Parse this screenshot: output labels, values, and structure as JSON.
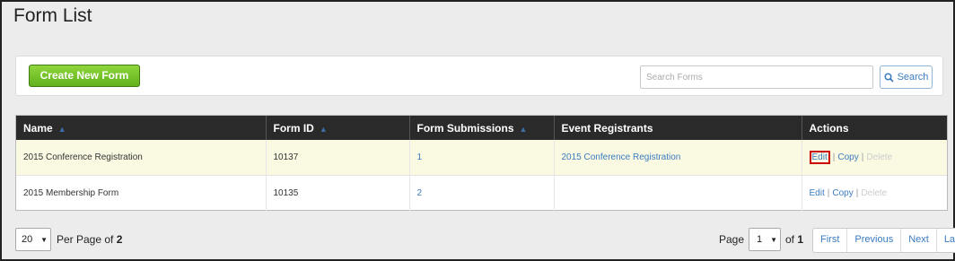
{
  "page": {
    "title": "Form List"
  },
  "toolbar": {
    "create_label": "Create New Form",
    "search_placeholder": "Search Forms",
    "search_label": "Search"
  },
  "table": {
    "columns": [
      "Name",
      "Form ID",
      "Form Submissions",
      "Event Registrants",
      "Actions"
    ],
    "rows": [
      {
        "name": "2015 Conference Registration",
        "form_id": "10137",
        "submissions": "1",
        "registrants": "2015 Conference Registration",
        "highlighted": true
      },
      {
        "name": "2015 Membership Form",
        "form_id": "10135",
        "submissions": "2",
        "registrants": "",
        "highlighted": false
      }
    ],
    "actions": {
      "edit": "Edit",
      "copy": "Copy",
      "delete": "Delete",
      "separator": "|"
    }
  },
  "pagination": {
    "per_page_value": "20",
    "per_page_prefix": "Per Page of",
    "total_pages": "2",
    "page_label": "Page",
    "current_page": "1",
    "of_label": "of",
    "page_count": "1",
    "buttons": [
      "First",
      "Previous",
      "Next",
      "Last"
    ]
  },
  "colors": {
    "accent_green": "#7ac943",
    "link_blue": "#3a7bbf",
    "header_dark": "#2a2a2a",
    "highlight_row": "#fafae3",
    "edit_outline": "#cc0000"
  }
}
